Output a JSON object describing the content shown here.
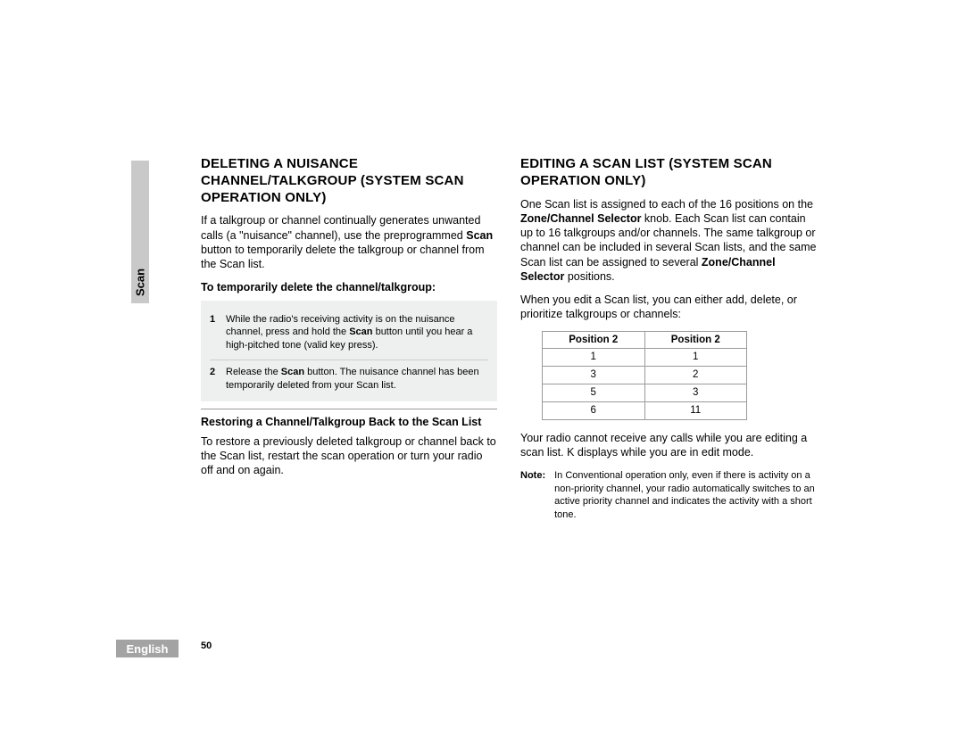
{
  "sideTab": "Scan",
  "langTab": "English",
  "pageNumber": "50",
  "left": {
    "heading": "DELETING A NUISANCE CHANNEL/TALKGROUP (SYSTEM SCAN OPERATION ONLY)",
    "intro_pre": "If a talkgroup or channel continually generates unwanted calls (a \"nuisance\" channel), use the preprogrammed ",
    "intro_bold": "Scan",
    "intro_post": " button to temporarily delete the talkgroup or channel from the Scan list.",
    "sub1": "To temporarily delete the channel/talkgroup:",
    "steps": [
      {
        "num": "1",
        "pre": "While the radio's receiving activity is on the nuisance channel, press and hold the ",
        "b": "Scan",
        "post": " button until you hear a high-pitched tone (valid key press)."
      },
      {
        "num": "2",
        "pre": "Release the ",
        "b": "Scan",
        "post": " button. The nuisance channel has been temporarily deleted from your Scan list."
      }
    ],
    "sub2": "Restoring a Channel/Talkgroup Back to the Scan List",
    "restore": "To restore a previously deleted talkgroup or channel back to the Scan list, restart the scan operation or turn your radio off and on again."
  },
  "right": {
    "heading": "EDITING A SCAN LIST (SYSTEM SCAN OPERATION ONLY)",
    "p1_a": "One Scan list is assigned to each of the 16 positions on the ",
    "p1_b1": "Zone/Channel Selector",
    "p1_c": " knob. Each Scan list can contain up to 16 talkgroups and/or channels. The same talkgroup or channel can be included in several Scan lists, and the same Scan list can be assigned to several ",
    "p1_b2": "Zone/Channel Selector",
    "p1_d": " positions.",
    "p2": "When you edit a Scan list, you can either add, delete, or prioritize talkgroups or channels:",
    "tableHeaders": [
      "Position 2",
      "Position 2"
    ],
    "tableRows": [
      [
        "1",
        "1",
        true,
        true
      ],
      [
        "3",
        "2",
        true,
        false
      ],
      [
        "5",
        "3",
        false,
        true
      ],
      [
        "6",
        "11",
        false,
        false
      ]
    ],
    "p3_a": "Your radio cannot receive any calls while you are editing a scan list. ",
    "p3_b": "K",
    "p3_c": " displays while you are in edit mode.",
    "noteLabel": "Note:",
    "noteText": "In Conventional operation only, even if there is activity on a non-priority channel, your radio automatically switches to an active priority channel and indicates the activity with a short tone."
  }
}
